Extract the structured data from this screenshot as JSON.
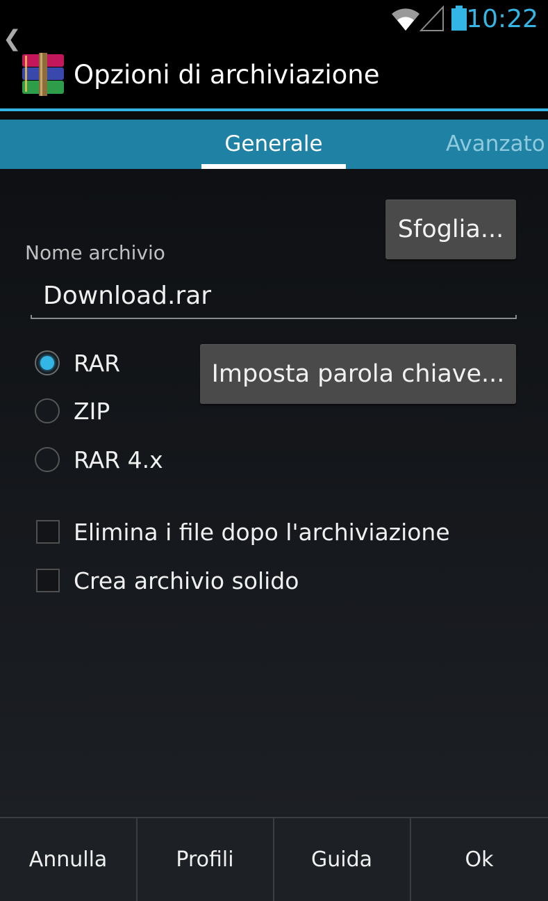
{
  "status_bar": {
    "time": "10:22",
    "icons": [
      "wifi-icon",
      "signal-icon",
      "battery-icon"
    ],
    "accent_color": "#33b5e5"
  },
  "action_bar": {
    "title": "Opzioni di archiviazione",
    "logo_icon": "winrar-books-icon",
    "up_icon": "chevron-left-icon"
  },
  "tabs": [
    {
      "label": "Generale",
      "selected": true
    },
    {
      "label": "Avanzato",
      "selected": false
    }
  ],
  "form": {
    "browse_label": "Sfoglia...",
    "archive_name_label": "Nome archivio",
    "archive_name_value": "Download.rar",
    "password_label": "Imposta parola chiave...",
    "formats": [
      {
        "label": "RAR",
        "checked": true
      },
      {
        "label": "ZIP",
        "checked": false
      },
      {
        "label": "RAR 4.x",
        "checked": false
      }
    ],
    "options": [
      {
        "label": "Elimina i file dopo l'archiviazione",
        "checked": false
      },
      {
        "label": "Crea archivio solido",
        "checked": false
      }
    ]
  },
  "bottom_buttons": {
    "cancel": "Annulla",
    "profiles": "Profili",
    "help": "Guida",
    "ok": "Ok"
  },
  "colors": {
    "tab_bar": "#1f82a4",
    "divider": "#33b5e5"
  }
}
